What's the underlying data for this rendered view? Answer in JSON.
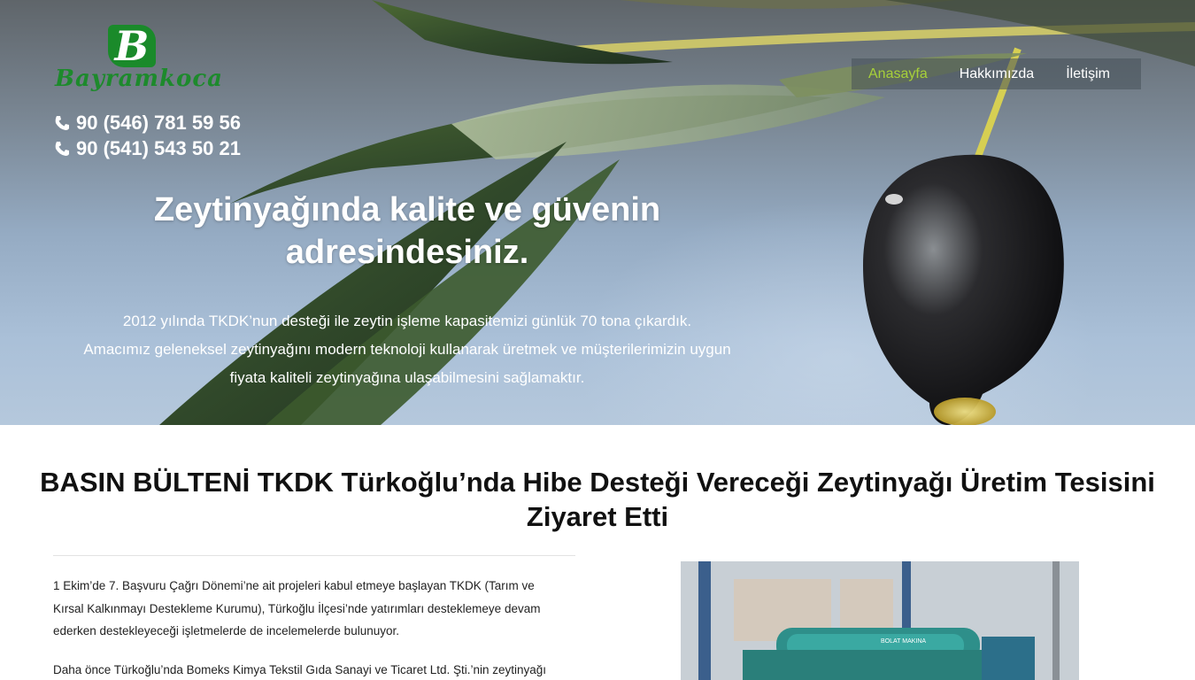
{
  "header": {
    "logo": {
      "letter": "B",
      "brand": "Bayramkoca"
    },
    "phones": [
      "90 (546) 781 59 56",
      "90 (541) 543 50 21"
    ],
    "nav": [
      {
        "label": "Anasayfa",
        "active": true
      },
      {
        "label": "Hakkımızda",
        "active": false
      },
      {
        "label": "İletişim",
        "active": false
      }
    ]
  },
  "hero": {
    "headline": "Zeytinyağında kalite ve güvenin adresindesiniz.",
    "intro": [
      "2012 yılında TKDK’nun desteği ile zeytin işleme kapasitemizi günlük 70 tona çıkardık.",
      "Amacımız geleneksel zeytinyağını modern teknoloji kullanarak üretmek ve müşterilerimizin uygun",
      "fiyata kaliteli zeytinyağına ulaşabilmesini sağlamaktır."
    ]
  },
  "article": {
    "title": "BASIN BÜLTENİ TKDK Türkoğlu’nda Hibe Desteği Vereceği Zeytinyağı Üretim Tesisini Ziyaret Etti",
    "paragraph1": [
      "1 Ekim’de 7. Başvuru Çağrı Dönemi’ne ait projeleri kabul etmeye başlayan TKDK (Tarım ve",
      "Kırsal Kalkınmayı Destekleme Kurumu), Türkoğlu İlçesi’nde yatırımları desteklemeye devam",
      "ederken destekleyeceği işletmelerde de incelemelerde bulunuyor."
    ],
    "paragraph2": "Daha önce Türkoğlu’nda Bomeks Kimya Tekstil Gıda Sanayi ve Ticaret Ltd. Şti.’nin zeytinyağı",
    "photo_label": "BOLAT MAKINA"
  },
  "colors": {
    "brand_green": "#1a8a2a",
    "nav_active": "#a7d03a",
    "nav_bg": "rgba(70,80,88,0.55)"
  }
}
